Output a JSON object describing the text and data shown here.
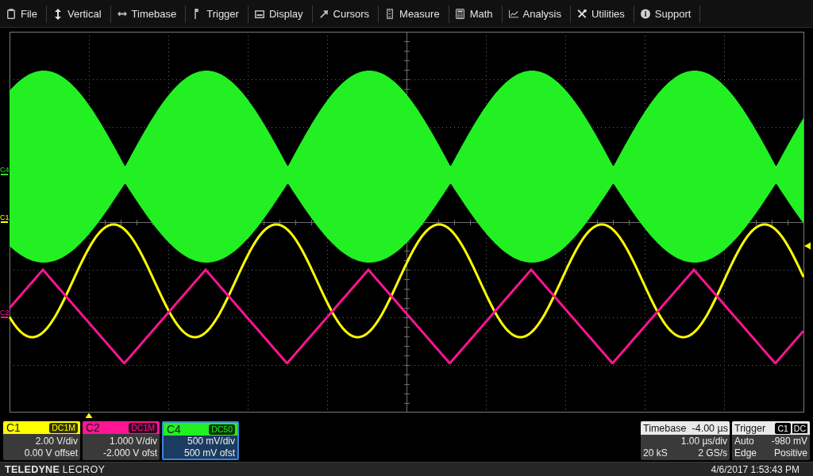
{
  "menu": [
    "File",
    "Vertical",
    "Timebase",
    "Trigger",
    "Display",
    "Cursors",
    "Measure",
    "Math",
    "Analysis",
    "Utilities",
    "Support"
  ],
  "graticule": {
    "markers": [
      {
        "label": "C4",
        "color": "#22f022"
      },
      {
        "label": "C1",
        "color": "#ffff00"
      },
      {
        "label": "C2",
        "color": "#ff1493"
      }
    ],
    "traces": [
      {
        "kind": "modulated",
        "color": "#22f022"
      },
      {
        "kind": "sine",
        "color": "#ffff00"
      },
      {
        "kind": "triangle",
        "color": "#ff1493"
      }
    ]
  },
  "channels": [
    {
      "name": "C1",
      "coupling": "DC1M",
      "scale": "2.00 V/div",
      "offset": "0.00 V offset",
      "color": "#ffff00",
      "selected": false
    },
    {
      "name": "C2",
      "coupling": "DC1M",
      "scale": "1.000 V/div",
      "offset": "-2.000 V ofst",
      "color": "#ff1493",
      "selected": false
    },
    {
      "name": "C4",
      "coupling": "DC50",
      "scale": "500 mV/div",
      "offset": "500 mV ofst",
      "color": "#22f022",
      "selected": true
    }
  ],
  "timebase": {
    "title": "Timebase",
    "delay": "-4.00 µs",
    "scale": "1.00 µs/div",
    "samples": "20 kS",
    "rate": "2 GS/s"
  },
  "trigger": {
    "title": "Trigger",
    "source": "C1",
    "coupling": "DC",
    "mode": "Auto",
    "level": "-980 mV",
    "type": "Edge",
    "slope": "Positive"
  },
  "footer": {
    "brand": "**TELEDYNE** LECROY",
    "datetime": "4/6/2017 1:53:43 PM"
  }
}
